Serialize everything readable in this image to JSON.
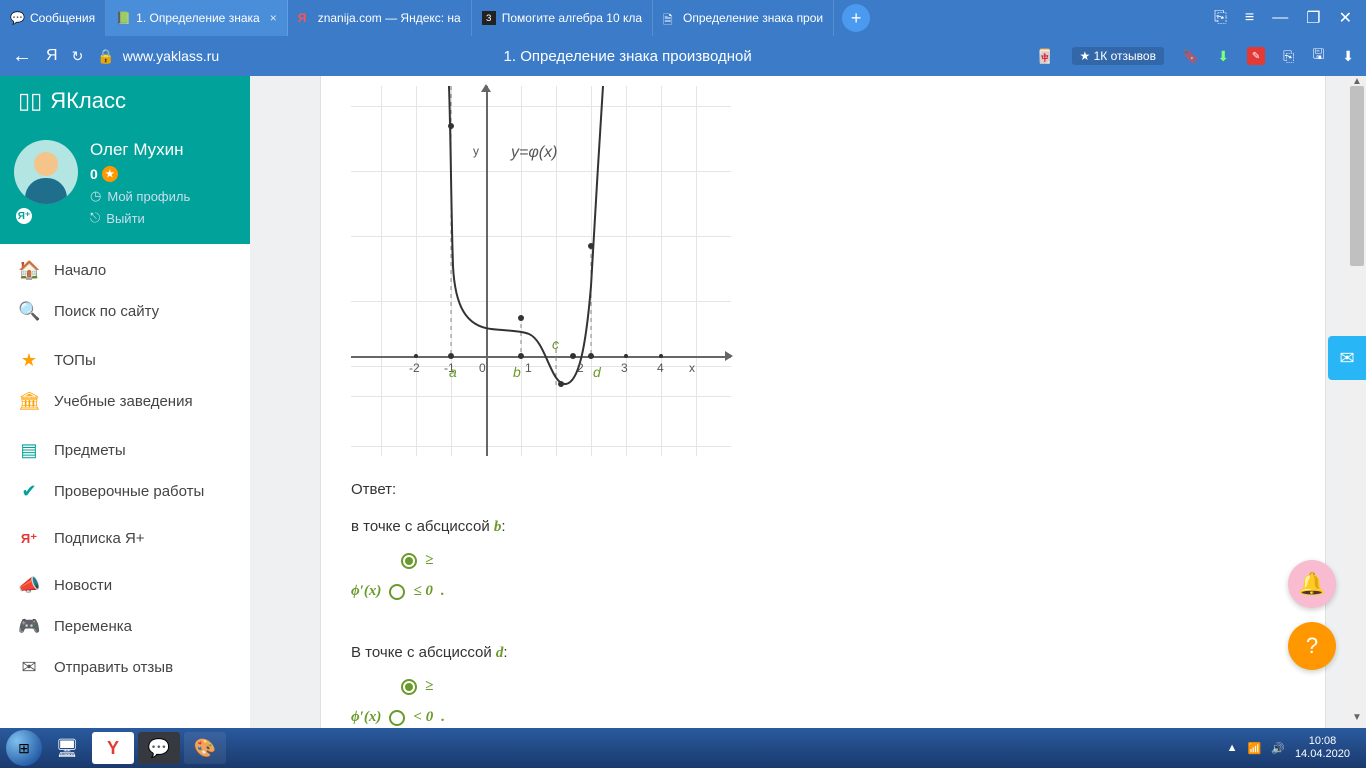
{
  "browser": {
    "tabs": [
      {
        "label": "Сообщения",
        "icon": "💬"
      },
      {
        "label": "1. Определение знака ",
        "icon": "📗",
        "active": true,
        "closable": true
      },
      {
        "label": "znanija.com — Яндекс: на",
        "icon": "Я"
      },
      {
        "label": "Помогите алгебра 10 кла",
        "icon": "З"
      },
      {
        "label": "Определение знака прои",
        "icon": "🗎"
      }
    ],
    "window_controls": [
      "—",
      "❐",
      "✕"
    ],
    "extra_icons": [
      "⎘",
      "≡"
    ]
  },
  "addressbar": {
    "back": "←",
    "ya": "Я",
    "reload": "↻",
    "lock": "🔒",
    "url": "www.yaklass.ru",
    "page_title": "1. Определение знака производной",
    "reviews": "★ 1К отзывов",
    "icons": [
      "⚑",
      "⬇",
      "🟥",
      "⎘",
      "💾",
      "⬇"
    ]
  },
  "site": {
    "logo": "ЯКласс",
    "user": {
      "name": "Олег Мухин",
      "points": "0",
      "profile": "Мой профиль",
      "logout": "Выйти"
    },
    "nav": [
      {
        "icon": "🏠",
        "label": "Начало",
        "color": "#00a299"
      },
      {
        "icon": "🔍",
        "label": "Поиск по сайту",
        "color": "#00a299"
      },
      {
        "sep": true
      },
      {
        "icon": "★",
        "label": "ТОПы",
        "color": "#ffa000"
      },
      {
        "icon": "🏛",
        "label": "Учебные заведения",
        "color": "#ffa000"
      },
      {
        "sep": true
      },
      {
        "icon": "📚",
        "label": "Предметы",
        "color": "#00a299"
      },
      {
        "icon": "✔",
        "label": "Проверочные работы",
        "color": "#00a299"
      },
      {
        "sep": true
      },
      {
        "icon": "Я⁺",
        "label": "Подписка Я+",
        "color": "#e53935"
      },
      {
        "sep": true
      },
      {
        "icon": "📢",
        "label": "Новости",
        "color": "#555"
      },
      {
        "icon": "☕",
        "label": "Переменка",
        "color": "#555"
      },
      {
        "icon": "✉",
        "label": "Отправить отзыв",
        "color": "#555"
      }
    ]
  },
  "content": {
    "answer_label": "Ответ:",
    "q1_prefix": "в точке с абсциссой ",
    "q1_var": "b",
    "q2_prefix": "В точке с абсциссой ",
    "q2_var": "d",
    "expr": "ϕ′(x)",
    "opt_ge": "≥",
    "opt_le": "≤ 0",
    "opt_lt": "< 0",
    "dot": "."
  },
  "chart_data": {
    "type": "line",
    "title": "y=φ(x)",
    "xlabel": "x",
    "ylabel": "y",
    "xlim": [
      -2.5,
      4.5
    ],
    "ylim": [
      -1.5,
      5
    ],
    "x_ticks": [
      -2,
      -1,
      0,
      1,
      2,
      3,
      4
    ],
    "marked_points": {
      "a": -1,
      "b": 1,
      "c": 1.5,
      "d": 2
    },
    "series": [
      {
        "name": "φ(x)",
        "x": [
          -1.05,
          -1,
          -0.9,
          -0.5,
          0,
          0.5,
          1,
          1.3,
          1.6,
          1.8,
          2,
          2.1,
          2.2
        ],
        "y": [
          5,
          4,
          2.2,
          0.6,
          0.3,
          0.25,
          0.2,
          -0.2,
          -0.6,
          -0.4,
          0.4,
          2.5,
          5
        ]
      }
    ]
  },
  "taskbar": {
    "apps": [
      "🌐",
      "💬",
      "🎨"
    ],
    "pinned": [
      "📁"
    ],
    "tray": [
      "▲",
      "📶",
      "🔊"
    ],
    "time": "10:08",
    "date": "14.04.2020"
  }
}
